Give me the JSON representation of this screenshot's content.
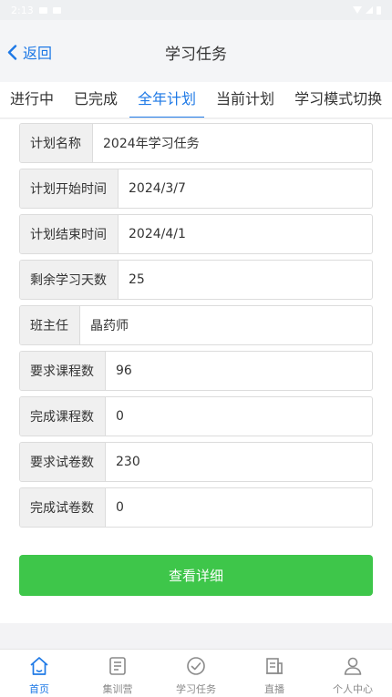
{
  "status_bar": {
    "time": "2:13"
  },
  "header": {
    "back_label": "返回",
    "title": "学习任务"
  },
  "tabs": [
    {
      "label": "进行中",
      "active": false
    },
    {
      "label": "已完成",
      "active": false
    },
    {
      "label": "全年计划",
      "active": true
    },
    {
      "label": "当前计划",
      "active": false
    },
    {
      "label": "学习模式切换",
      "active": false
    }
  ],
  "plan": {
    "fields": [
      {
        "label": "计划名称",
        "value": "2024年学习任务"
      },
      {
        "label": "计划开始时间",
        "value": "2024/3/7"
      },
      {
        "label": "计划结束时间",
        "value": "2024/4/1"
      },
      {
        "label": "剩余学习天数",
        "value": "25"
      },
      {
        "label": "班主任",
        "value": "晶药师"
      },
      {
        "label": "要求课程数",
        "value": "96"
      },
      {
        "label": "完成课程数",
        "value": "0"
      },
      {
        "label": "要求试卷数",
        "value": "230"
      },
      {
        "label": "完成试卷数",
        "value": "0"
      }
    ],
    "detail_button": "查看详细"
  },
  "bottom_nav": [
    {
      "label": "首页",
      "icon": "home-icon",
      "active": true
    },
    {
      "label": "集训营",
      "icon": "list-icon",
      "active": false
    },
    {
      "label": "学习任务",
      "icon": "check-circle-icon",
      "active": false
    },
    {
      "label": "直播",
      "icon": "live-icon",
      "active": false
    },
    {
      "label": "个人中心",
      "icon": "user-icon",
      "active": false
    }
  ],
  "colors": {
    "accent": "#1e79e6",
    "button": "#3ec64a",
    "inactive": "#8a8a8a"
  }
}
